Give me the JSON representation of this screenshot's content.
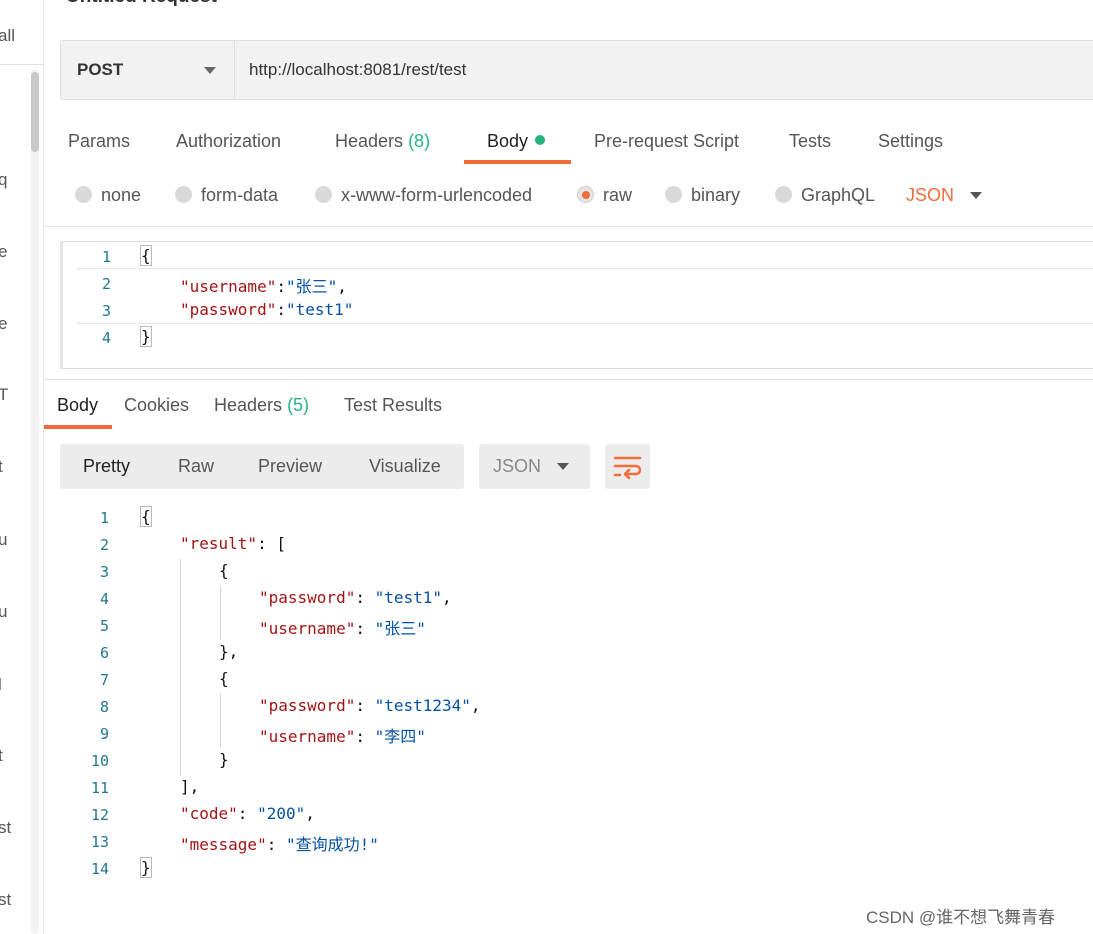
{
  "page_title_fragment": "Untitled Request",
  "sidebar_fragments": [
    "all",
    "q",
    "e",
    "e",
    "T",
    "t",
    "u",
    "u",
    "l",
    "t",
    "st",
    "st"
  ],
  "request": {
    "method": "POST",
    "url": "http://localhost:8081/rest/test"
  },
  "request_tabs": {
    "params": "Params",
    "authorization": "Authorization",
    "headers": "Headers",
    "headers_count": "(8)",
    "body": "Body",
    "prerequest": "Pre-request Script",
    "tests": "Tests",
    "settings": "Settings"
  },
  "body_types": {
    "none": "none",
    "form_data": "form-data",
    "urlencoded": "x-www-form-urlencoded",
    "raw": "raw",
    "binary": "binary",
    "graphql": "GraphQL",
    "format": "JSON",
    "selected": "raw"
  },
  "request_body": {
    "line_numbers": [
      "1",
      "2",
      "3",
      "4"
    ],
    "open_brace": "{",
    "close_brace": "}",
    "line2_key": "\"username\"",
    "line2_value": "\"张三\"",
    "line3_key": "\"password\"",
    "line3_value": "\"test1\""
  },
  "response_tabs": {
    "body": "Body",
    "cookies": "Cookies",
    "headers": "Headers",
    "headers_count": "(5)",
    "test_results": "Test Results"
  },
  "response_toolbar": {
    "pretty": "Pretty",
    "raw": "Raw",
    "preview": "Preview",
    "visualize": "Visualize",
    "format": "JSON"
  },
  "response_body": {
    "line_numbers": [
      "1",
      "2",
      "3",
      "4",
      "5",
      "6",
      "7",
      "8",
      "9",
      "10",
      "11",
      "12",
      "13",
      "14"
    ],
    "open_brace": "{",
    "close_brace": "}",
    "result_key": "\"result\"",
    "obj_open": "{",
    "obj1_close": "},",
    "obj2_close": "}",
    "arr_close": "],",
    "o1_password_key": "\"password\"",
    "o1_password_val": "\"test1\"",
    "o1_username_key": "\"username\"",
    "o1_username_val": "\"张三\"",
    "o2_password_key": "\"password\"",
    "o2_password_val": "\"test1234\"",
    "o2_username_key": "\"username\"",
    "o2_username_val": "\"李四\"",
    "code_key": "\"code\"",
    "code_val": "\"200\"",
    "message_key": "\"message\"",
    "message_val": "\"查询成功!\""
  },
  "watermark": "CSDN @谁不想飞舞青春",
  "colors": {
    "accent": "#f26b3a",
    "success": "#26b47f",
    "json_key": "#a31515",
    "json_string": "#0451a5",
    "line_number": "#237893"
  }
}
